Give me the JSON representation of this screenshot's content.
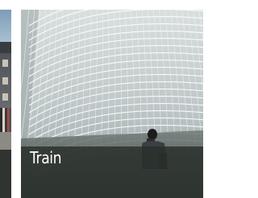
{
  "tiles": [
    {
      "id": "left-tile",
      "caption": ""
    },
    {
      "id": "main-tile",
      "caption": "Train"
    }
  ],
  "colors": {
    "caption_bar": "#282e2a",
    "caption_text": "#ffffff",
    "roof_lattice": "#ffffff",
    "roof_background": "#c3cccd"
  }
}
